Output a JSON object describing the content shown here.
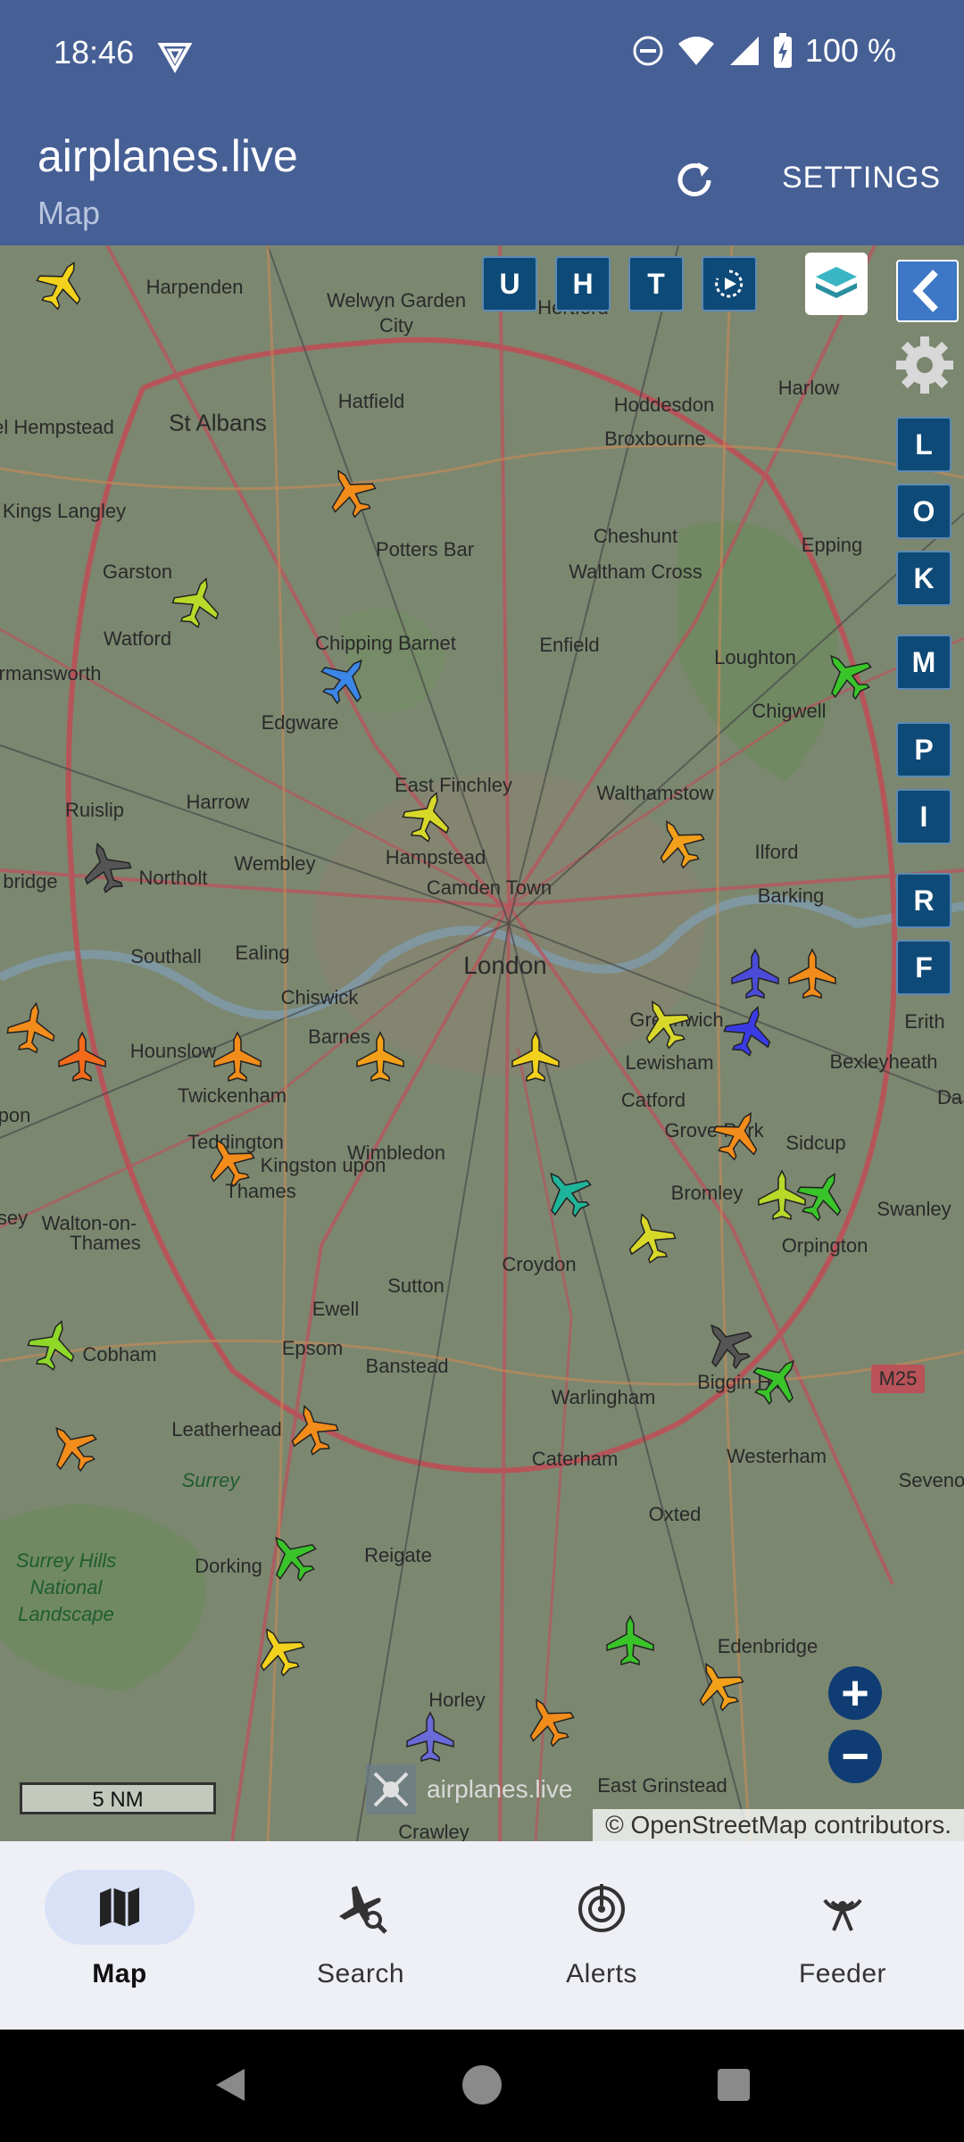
{
  "status_bar": {
    "time": "18:46",
    "battery": "100 %"
  },
  "app_bar": {
    "title": "airplanes.live",
    "subtitle": "Map",
    "settings_label": "SETTINGS"
  },
  "map": {
    "top_buttons": [
      "U",
      "H",
      "T"
    ],
    "side_buttons": [
      "L",
      "O",
      "K",
      "M",
      "P",
      "I",
      "R",
      "F"
    ],
    "zoom_in": "+",
    "zoom_out": "−",
    "scale_label": "5 NM",
    "watermark": "airplanes.live",
    "attribution": "© OpenStreetMap contributors.",
    "places": [
      {
        "name": "Harpenden"
      },
      {
        "name": "Welwyn Garden"
      },
      {
        "name": "City"
      },
      {
        "name": "Hertford"
      },
      {
        "name": "Harlow"
      },
      {
        "name": "St Albans"
      },
      {
        "name": "Hatfield"
      },
      {
        "name": "Hoddesdon"
      },
      {
        "name": "el Hempstead"
      },
      {
        "name": "Broxbourne"
      },
      {
        "name": "Kings Langley"
      },
      {
        "name": "Cheshunt"
      },
      {
        "name": "Potters Bar"
      },
      {
        "name": "Epping"
      },
      {
        "name": "Waltham Cross"
      },
      {
        "name": "Garston"
      },
      {
        "name": "Watford"
      },
      {
        "name": "Chipping Barnet"
      },
      {
        "name": "Enfield"
      },
      {
        "name": "Loughton"
      },
      {
        "name": "rmansworth"
      },
      {
        "name": "Chigwell"
      },
      {
        "name": "Edgware"
      },
      {
        "name": "East Finchley"
      },
      {
        "name": "Ruislip"
      },
      {
        "name": "Harrow"
      },
      {
        "name": "Walthamstow"
      },
      {
        "name": "Hampstead"
      },
      {
        "name": "Ilford"
      },
      {
        "name": "bridge"
      },
      {
        "name": "Northolt"
      },
      {
        "name": "Wembley"
      },
      {
        "name": "Camden Town"
      },
      {
        "name": "Barking"
      },
      {
        "name": "Southall"
      },
      {
        "name": "Ealing"
      },
      {
        "name": "London"
      },
      {
        "name": "Chiswick"
      },
      {
        "name": "Barnes"
      },
      {
        "name": "Greenwich"
      },
      {
        "name": "Erith"
      },
      {
        "name": "Hounslow"
      },
      {
        "name": "Lewisham"
      },
      {
        "name": "Bexleyheath"
      },
      {
        "name": "Twickenham"
      },
      {
        "name": "Catford"
      },
      {
        "name": "pon"
      },
      {
        "name": "Teddington"
      },
      {
        "name": "Kingston upon"
      },
      {
        "name": "Grove Park"
      },
      {
        "name": "Sidcup"
      },
      {
        "name": "Wimbledon"
      },
      {
        "name": "Thames"
      },
      {
        "name": "Bromley"
      },
      {
        "name": "Swanley"
      },
      {
        "name": "sey"
      },
      {
        "name": "Walton-on-"
      },
      {
        "name": "Thames"
      },
      {
        "name": "Orpington"
      },
      {
        "name": "Croydon"
      },
      {
        "name": "Sutton"
      },
      {
        "name": "Ewell"
      },
      {
        "name": "Cobham"
      },
      {
        "name": "Epsom"
      },
      {
        "name": "Banstead"
      },
      {
        "name": "Biggin Hill"
      },
      {
        "name": "M25"
      },
      {
        "name": "Warlingham"
      },
      {
        "name": "Leatherhead"
      },
      {
        "name": "Caterham"
      },
      {
        "name": "Sevenoa"
      },
      {
        "name": "Surrey"
      },
      {
        "name": "Westerham"
      },
      {
        "name": "Oxted"
      },
      {
        "name": "Dorking"
      },
      {
        "name": "Reigate"
      },
      {
        "name": "Edenbridge"
      },
      {
        "name": "Horley"
      },
      {
        "name": "East Grinstead"
      },
      {
        "name": "Crawley"
      },
      {
        "name": "Da"
      },
      {
        "name": "Surrey Hills National Landscape"
      }
    ]
  },
  "bottom_nav": [
    {
      "label": "Map",
      "active": true,
      "icon": "map-icon"
    },
    {
      "label": "Search",
      "active": false,
      "icon": "plane-search-icon"
    },
    {
      "label": "Alerts",
      "active": false,
      "icon": "radar-alert-icon"
    },
    {
      "label": "Feeder",
      "active": false,
      "icon": "antenna-icon"
    }
  ],
  "colors": {
    "app_bar": "#465f95",
    "map_button": "#0e4a77",
    "nav_background": "#eef0f6",
    "nav_active_pill": "#d9e1f7"
  }
}
